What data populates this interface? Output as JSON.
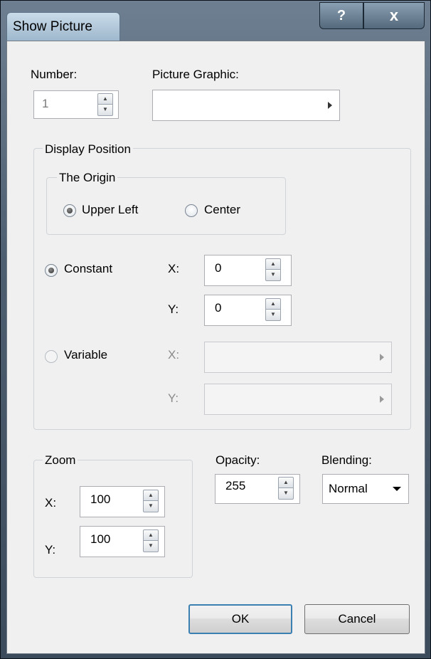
{
  "window": {
    "title": "Show Picture",
    "help_label": "?",
    "close_label": "x"
  },
  "number": {
    "label": "Number:",
    "value": "1"
  },
  "picture_graphic": {
    "label": "Picture Graphic:",
    "value": ""
  },
  "display_position": {
    "group_label": "Display Position",
    "origin": {
      "group_label": "The Origin",
      "options": [
        "Upper Left",
        "Center"
      ],
      "selected": "Upper Left"
    },
    "constant": {
      "label": "Constant",
      "selected": true,
      "x_label": "X:",
      "x_value": "0",
      "y_label": "Y:",
      "y_value": "0"
    },
    "variable": {
      "label": "Variable",
      "selected": false,
      "x_label": "X:",
      "x_value": "",
      "y_label": "Y:",
      "y_value": ""
    }
  },
  "zoom": {
    "group_label": "Zoom",
    "x_label": "X:",
    "x_value": "100",
    "y_label": "Y:",
    "y_value": "100"
  },
  "opacity": {
    "label": "Opacity:",
    "value": "255"
  },
  "blending": {
    "label": "Blending:",
    "selected": "Normal"
  },
  "buttons": {
    "ok": "OK",
    "cancel": "Cancel"
  },
  "colors": {
    "frame": "#4d5e70",
    "client_bg": "#f0f0f0",
    "default_button_border": "#3c7fb1"
  }
}
